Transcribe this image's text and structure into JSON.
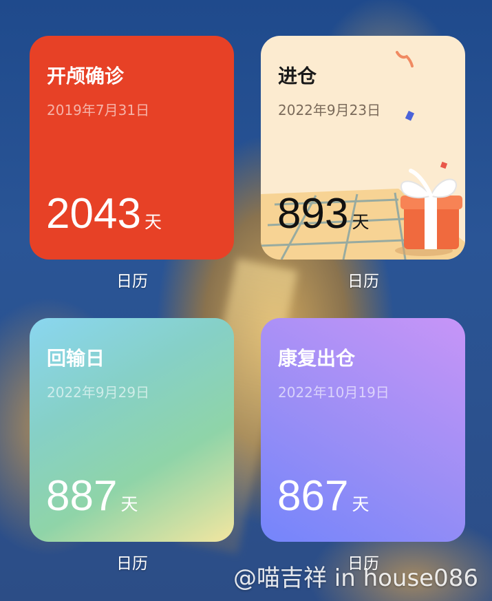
{
  "widgets": [
    {
      "title": "开颅确诊",
      "date": "2019年7月31日",
      "count": "2043",
      "unit": "天",
      "caption": "日历"
    },
    {
      "title": "进仓",
      "date": "2022年9月23日",
      "count": "893",
      "unit": "天",
      "caption": "日历"
    },
    {
      "title": "回输日",
      "date": "2022年9月29日",
      "count": "887",
      "unit": "天",
      "caption": "日历"
    },
    {
      "title": "康复出仓",
      "date": "2022年10月19日",
      "count": "867",
      "unit": "天",
      "caption": "日历"
    }
  ],
  "colors": {
    "widget1": "#e74126",
    "widget2": "#fcebd0",
    "widget3": "#8fd4a8",
    "widget4": "#9a8ef5"
  },
  "icons": [
    "gift-box-icon",
    "confetti-icon"
  ],
  "watermark": "@喵吉祥 in house086"
}
